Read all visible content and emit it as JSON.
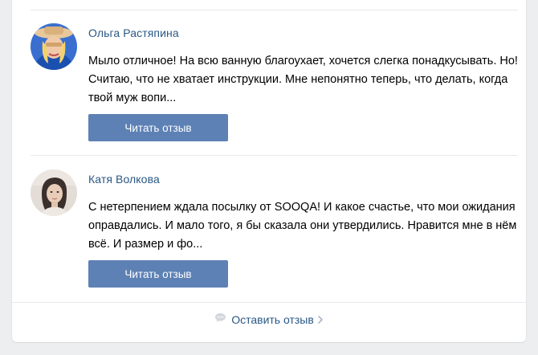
{
  "reviews": [
    {
      "author": "Ольга Растяпина",
      "text": "Мыло отличное! На всю ванную благоухает, хочется слегка понадкусывать. Но! Считаю, что не хватает инструкции. Мне непонятно теперь, что делать, когда твой муж вопи...",
      "button_label": "Читать отзыв"
    },
    {
      "author": "Катя Волкова",
      "text": "С нетерпением ждала посылку от SOOQA! И какое счастье, что мои ожидания оправдались. И мало того, я бы сказала они утвердились. Нравится мне в нём всё. И размер и фо...",
      "button_label": "Читать отзыв"
    }
  ],
  "footer": {
    "leave_review_label": "Оставить отзыв",
    "icon": "speech-bubble-icon",
    "chevron": "chevron-right-icon"
  },
  "colors": {
    "link": "#2a5885",
    "button": "#5d81b5",
    "background": "#edeef0"
  }
}
